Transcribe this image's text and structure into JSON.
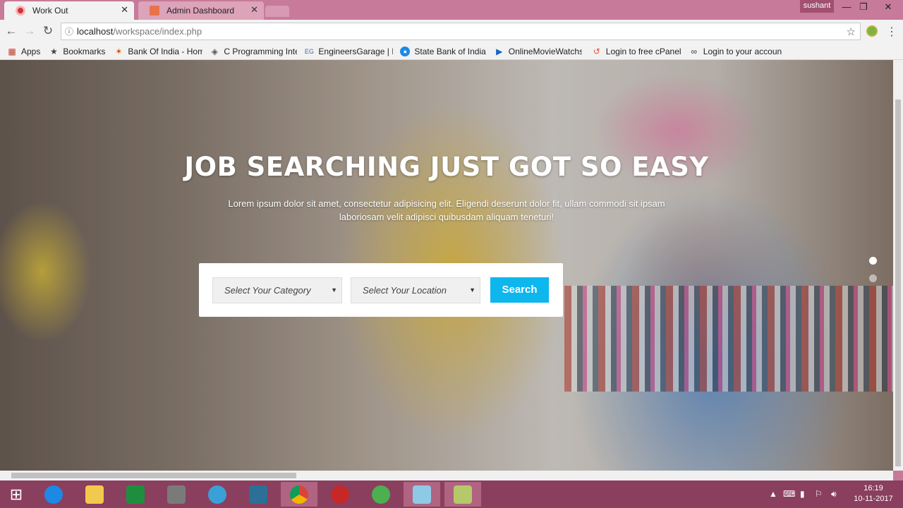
{
  "browser": {
    "tabs": [
      {
        "title": "Work Out",
        "active": true
      },
      {
        "title": "Admin Dashboard",
        "active": false
      }
    ],
    "profile_name": "sushant",
    "url_host": "localhost",
    "url_path": "/workspace/index.php",
    "bookmarks": [
      {
        "label": "Apps",
        "icon": "apps-icon"
      },
      {
        "label": "Bookmarks",
        "icon": "star-icon"
      },
      {
        "label": "Bank Of India - Home",
        "icon": "bank-icon"
      },
      {
        "label": "C Programming Inter",
        "icon": "diamond-icon"
      },
      {
        "label": "EngineersGarage | In:",
        "icon": "eg-icon"
      },
      {
        "label": "State Bank of India",
        "icon": "sbi-icon"
      },
      {
        "label": "OnlineMovieWatchs.",
        "icon": "play-icon"
      },
      {
        "label": "Login to free cPanel",
        "icon": "cpanel-icon"
      },
      {
        "label": "Login to your accoun",
        "icon": "infinity-icon"
      }
    ]
  },
  "hero": {
    "title": "JOB SEARCHING JUST GOT SO EASY",
    "subtitle": "Lorem ipsum dolor sit amet, consectetur adipisicing elit. Eligendi deserunt dolor fit, ullam commodi sit ipsam laboriosam velit adipisci quibusdam aliquam teneturi!"
  },
  "search": {
    "category_placeholder": "Select Your Category",
    "location_placeholder": "Select Your Location",
    "button_label": "Search"
  },
  "colors": {
    "accent": "#0eb6ee",
    "taskbar": "#8a3f5e",
    "titlebar": "#c77a99"
  },
  "taskbar": {
    "time": "16:19",
    "date": "10-11-2017"
  }
}
